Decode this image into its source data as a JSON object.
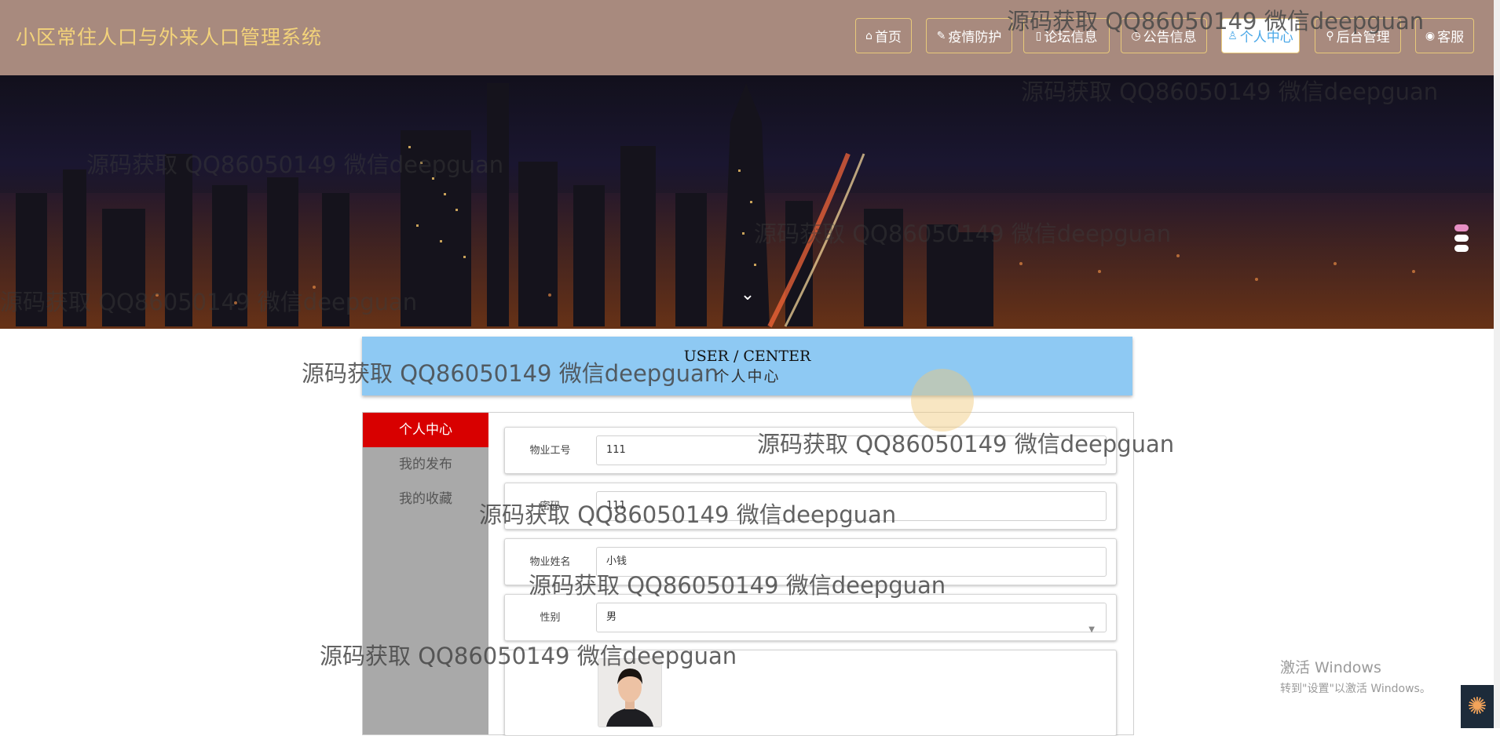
{
  "header": {
    "title": "小区常住人口与外来人口管理系统"
  },
  "nav": [
    {
      "icon": "⌂",
      "label": "首页",
      "active": false
    },
    {
      "icon": "✎",
      "label": "疫情防护",
      "active": false
    },
    {
      "icon": "▯",
      "label": "论坛信息",
      "active": false
    },
    {
      "icon": "◷",
      "label": "公告信息",
      "active": false
    },
    {
      "icon": "♙",
      "label": "个人中心",
      "active": true
    },
    {
      "icon": "⚲",
      "label": "后台管理",
      "active": false
    },
    {
      "icon": "◉",
      "label": "客服",
      "active": false
    }
  ],
  "center": {
    "en": "USER / CENTER",
    "cn": "个人中心"
  },
  "sidebar": [
    {
      "label": "个人中心",
      "active": true
    },
    {
      "label": "我的发布",
      "active": false
    },
    {
      "label": "我的收藏",
      "active": false
    }
  ],
  "form": {
    "fields": [
      {
        "label": "物业工号",
        "value": "111"
      },
      {
        "label": "密码",
        "value": "111"
      },
      {
        "label": "物业姓名",
        "value": "小钱"
      },
      {
        "label": "性别",
        "value": "男"
      }
    ]
  },
  "watermark": "源码获取 QQ86050149 微信deepguan",
  "windows": {
    "line1": "激活 Windows",
    "line2": "转到\"设置\"以激活 Windows。"
  },
  "colors": {
    "header_bg": "#a88a7e",
    "title": "#f3d37a",
    "center_bg": "#8ec9f3",
    "sidebar_active": "#d80000"
  }
}
